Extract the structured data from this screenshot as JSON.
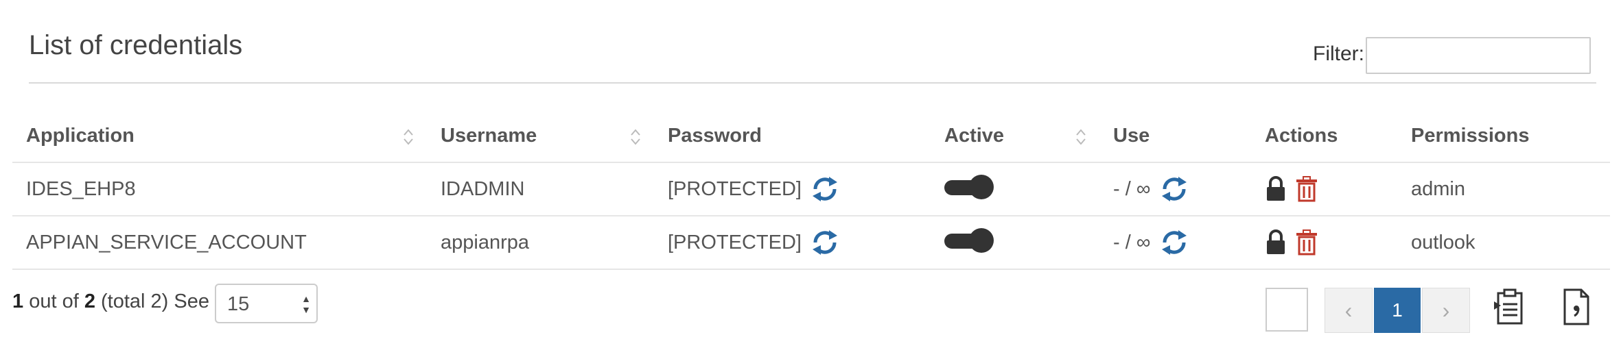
{
  "header": {
    "title": "List of credentials",
    "filter_label": "Filter:",
    "filter_value": ""
  },
  "table": {
    "columns": [
      "Application",
      "Username",
      "Password",
      "Active",
      "Use",
      "Actions",
      "Permissions"
    ],
    "rows": [
      {
        "application": "IDES_EHP8",
        "username": "IDADMIN",
        "password": "[PROTECTED]",
        "active": true,
        "use": "- / ∞",
        "permissions": "admin"
      },
      {
        "application": "APPIAN_SERVICE_ACCOUNT",
        "username": "appianrpa",
        "password": "[PROTECTED]",
        "active": true,
        "use": "- / ∞",
        "permissions": "outlook"
      }
    ]
  },
  "footer": {
    "range_start": "1",
    "range_mid": " out of ",
    "range_end": "2",
    "total_text": " (total 2)",
    "see_label": "See",
    "page_size": "15",
    "current_page": "1",
    "prev_symbol": "‹",
    "next_symbol": "›"
  },
  "colors": {
    "accent": "#2a6aa5",
    "danger": "#c0392b",
    "icon_dark": "#333333"
  },
  "icons": [
    "sort-icon",
    "refresh-icon",
    "lock-icon",
    "trash-icon",
    "toggle-icon",
    "clipboard-icon",
    "csv-file-icon"
  ]
}
